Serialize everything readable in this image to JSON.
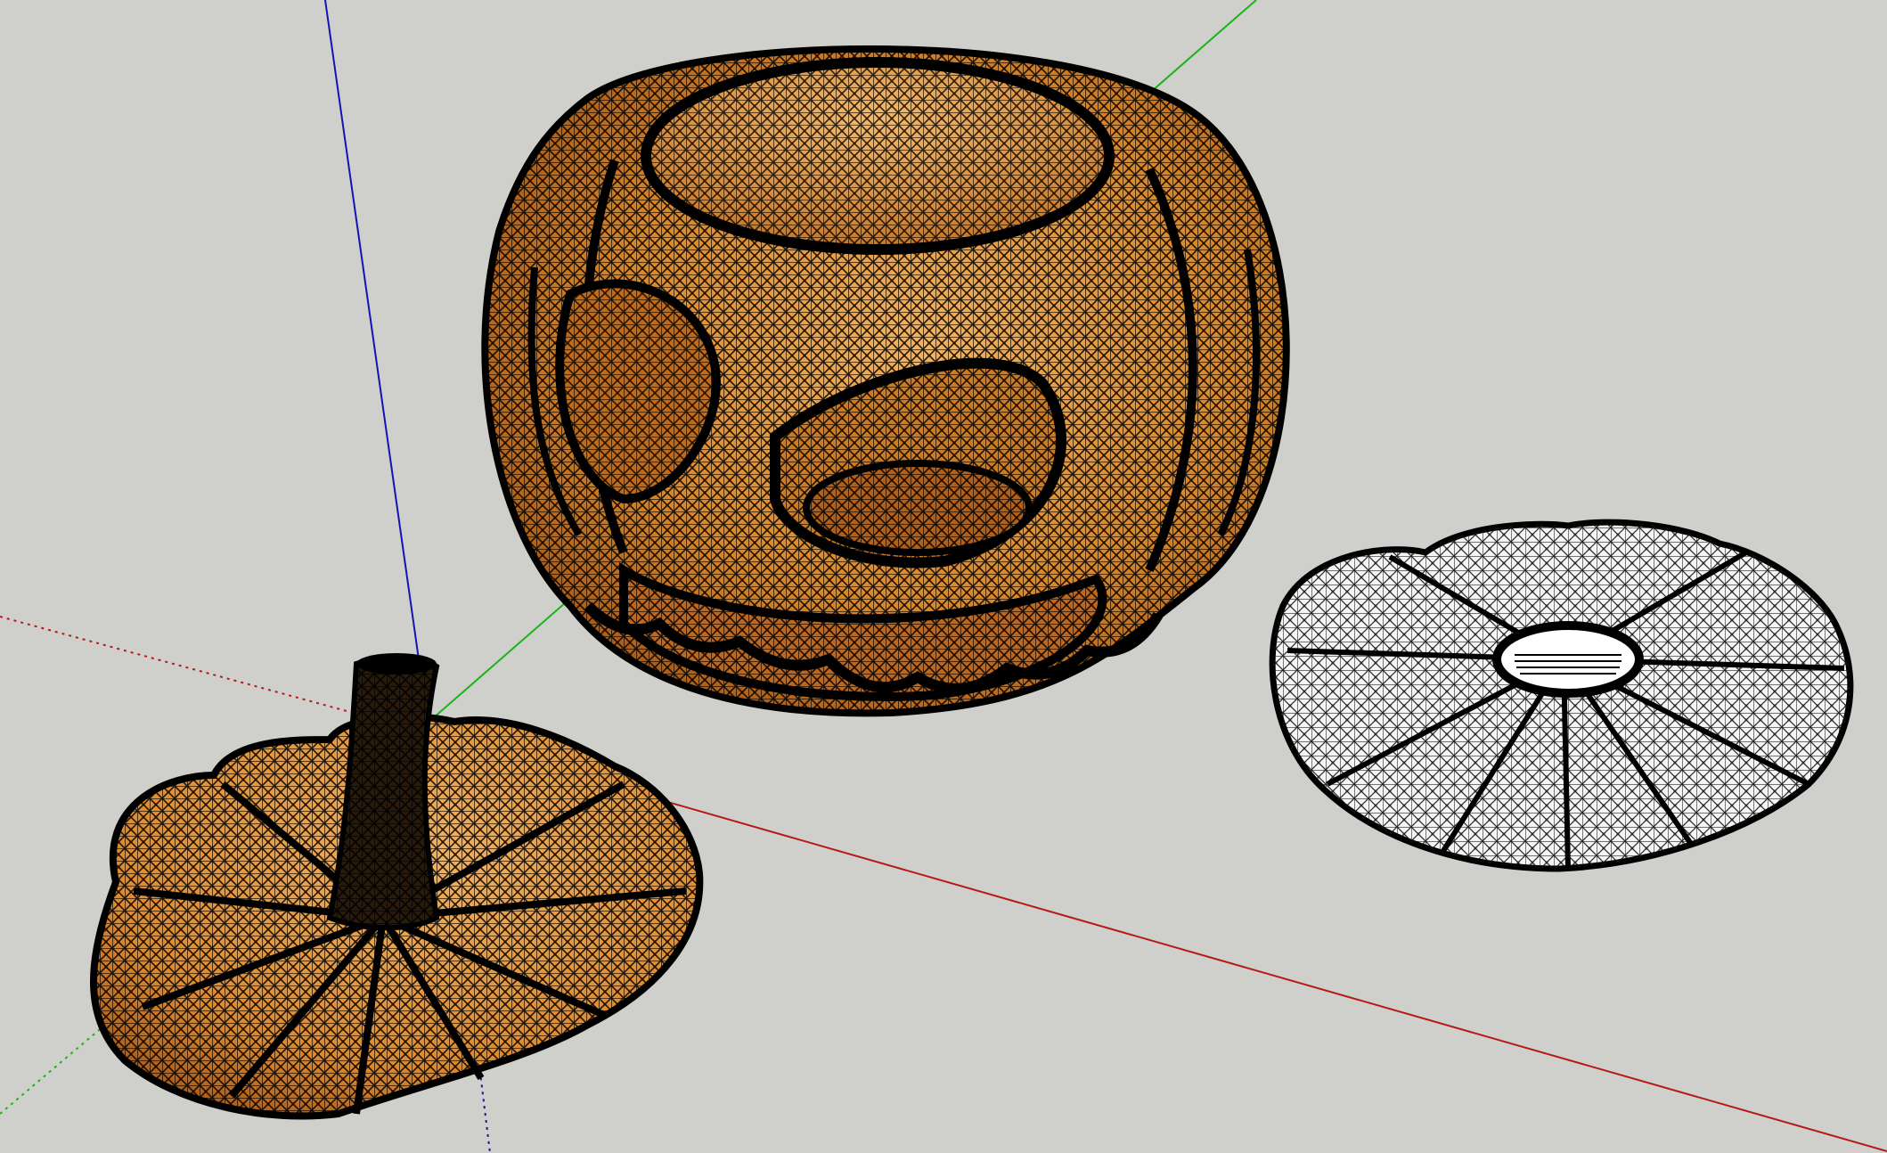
{
  "viewport": {
    "background": "#cfcfcb"
  },
  "axes": {
    "red": "#b51a1a",
    "green": "#18b418",
    "blue": "#1414b4"
  },
  "models": [
    {
      "name": "pumpkin-body",
      "material": "orange",
      "style": "wireframe-dense"
    },
    {
      "name": "pumpkin-lid-with-stem",
      "material": "orange",
      "style": "wireframe-dense"
    },
    {
      "name": "pumpkin-lid-underside",
      "material": "white",
      "style": "wireframe-dense"
    }
  ],
  "colors": {
    "orange_light": "#f2a447",
    "orange_mid": "#d9801f",
    "orange_dark": "#9c4a08",
    "mesh": "#000000",
    "white_mesh_face": "#f4f4f4"
  }
}
